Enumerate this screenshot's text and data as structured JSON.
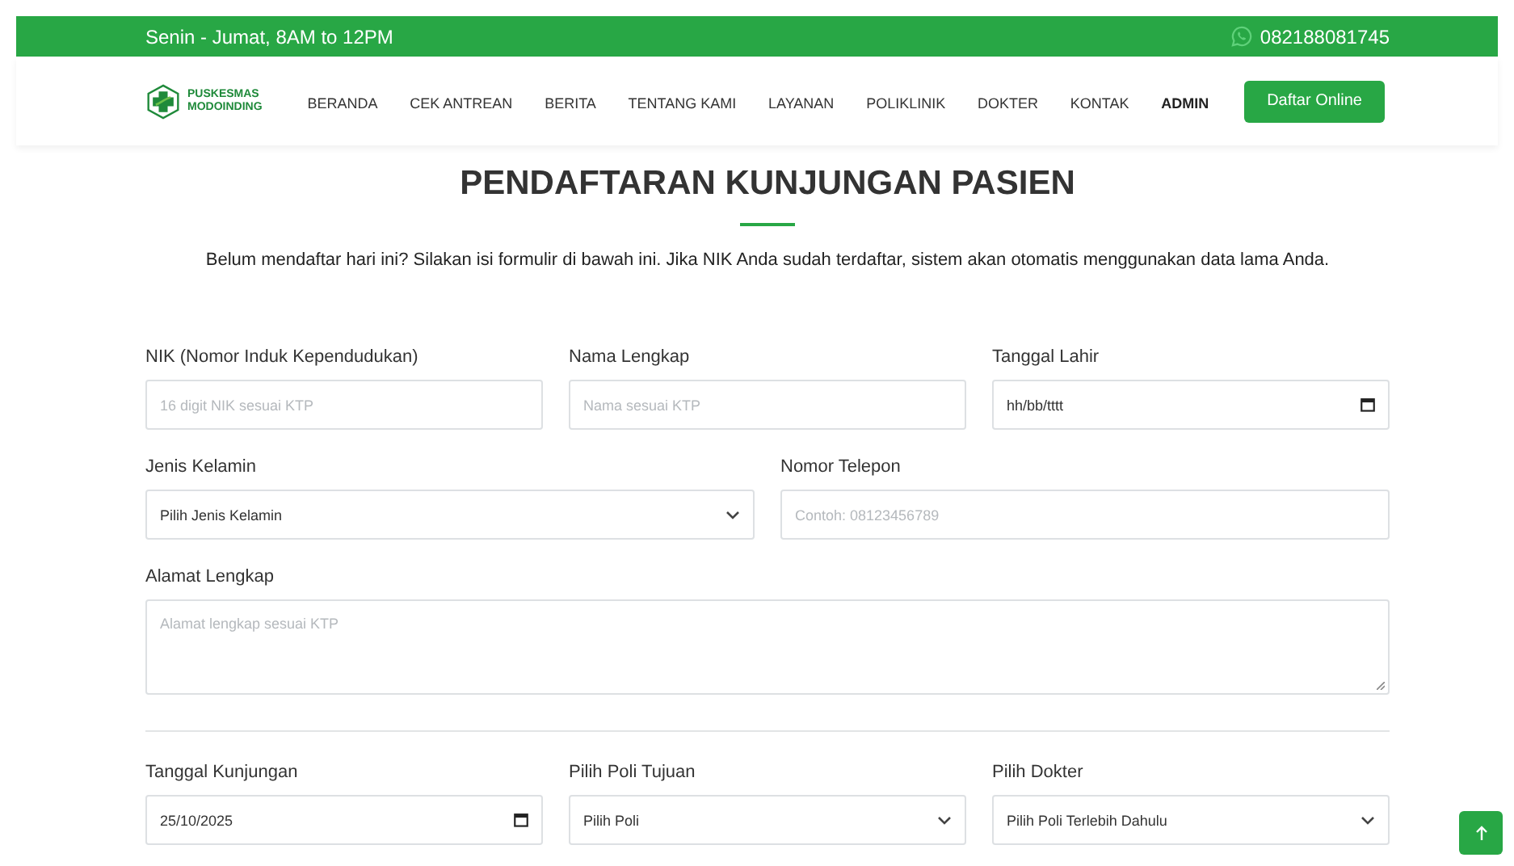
{
  "top_bar": {
    "hours": "Senin - Jumat, 8AM to 12PM",
    "phone": "082188081745"
  },
  "nav": {
    "logo_lines": [
      "PUSKESMAS",
      "MODOINDING"
    ],
    "items": [
      {
        "label": "BERANDA",
        "emphasized": false
      },
      {
        "label": "CEK ANTREAN",
        "emphasized": false
      },
      {
        "label": "BERITA",
        "emphasized": false
      },
      {
        "label": "TENTANG KAMI",
        "emphasized": false
      },
      {
        "label": "LAYANAN",
        "emphasized": false
      },
      {
        "label": "POLIKLINIK",
        "emphasized": false
      },
      {
        "label": "DOKTER",
        "emphasized": false
      },
      {
        "label": "KONTAK",
        "emphasized": false
      },
      {
        "label": "ADMIN",
        "emphasized": true
      }
    ],
    "cta": "Daftar Online"
  },
  "heading": "PENDAFTARAN KUNJUNGAN PASIEN",
  "intro": "Belum mendaftar hari ini? Silakan isi formulir di bawah ini. Jika NIK Anda sudah terdaftar, sistem akan otomatis menggunakan data lama Anda.",
  "form_sections": [
    {
      "rows": [
        [
          {
            "label": "NIK (Nomor Induk Kependudukan)",
            "kind": "text",
            "placeholder": "16 digit NIK sesuai KTP"
          },
          {
            "label": "Nama Lengkap",
            "kind": "text",
            "placeholder": "Nama sesuai KTP"
          },
          {
            "label": "Tanggal Lahir",
            "kind": "date",
            "value": "hh/bb/tttt"
          }
        ],
        [
          {
            "label": "Jenis Kelamin",
            "kind": "select",
            "value": "Pilih Jenis Kelamin"
          },
          {
            "label": "Nomor Telepon",
            "kind": "text",
            "placeholder": "Contoh: 08123456789"
          }
        ],
        [
          {
            "label": "Alamat Lengkap",
            "kind": "textarea",
            "placeholder": "Alamat lengkap sesuai KTP"
          }
        ]
      ]
    },
    {
      "rows": [
        [
          {
            "label": "Tanggal Kunjungan",
            "kind": "date",
            "value": "25/10/2025"
          },
          {
            "label": "Pilih Poli Tujuan",
            "kind": "select",
            "value": "Pilih Poli"
          },
          {
            "label": "Pilih Dokter",
            "kind": "select",
            "value": "Pilih Poli Terlebih Dahulu"
          }
        ]
      ]
    }
  ]
}
